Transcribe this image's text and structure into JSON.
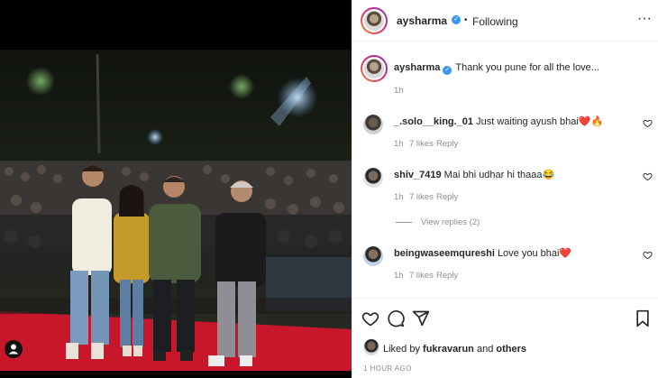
{
  "post": {
    "username": "aysharma",
    "separator": "•",
    "follow_label": "Following",
    "more_label": "···"
  },
  "caption": {
    "username": "aysharma",
    "text": "Thank you pune for all the love...",
    "time": "1h"
  },
  "comments": [
    {
      "username": "_.solo__king._01",
      "text": "Just waiting ayush bhai❤️🔥",
      "time": "1h",
      "likes": "7 likes",
      "reply": "Reply"
    },
    {
      "username": "shiv_7419",
      "text": "Mai bhi udhar hi thaaa😂",
      "time": "1h",
      "likes": "7 likes",
      "reply": "Reply",
      "view_replies": "View replies (2)"
    },
    {
      "username": "beingwaseemqureshi",
      "text": "Love you bhai❤️",
      "time": "1h",
      "likes": "7 likes",
      "reply": "Reply"
    }
  ],
  "footer": {
    "liked_prefix": "Liked by",
    "liked_user": "fukravarun",
    "liked_and": "and",
    "liked_others": "others",
    "timestamp": "1 HOUR AGO"
  },
  "colors": {
    "accent": "#3897f0",
    "secondary_text": "#8e8e8e",
    "stage": "#c8162a"
  },
  "icons": [
    "verified-badge-icon",
    "heart-icon",
    "comment-icon",
    "share-icon",
    "bookmark-icon",
    "tag-people-icon",
    "more-options-icon"
  ]
}
